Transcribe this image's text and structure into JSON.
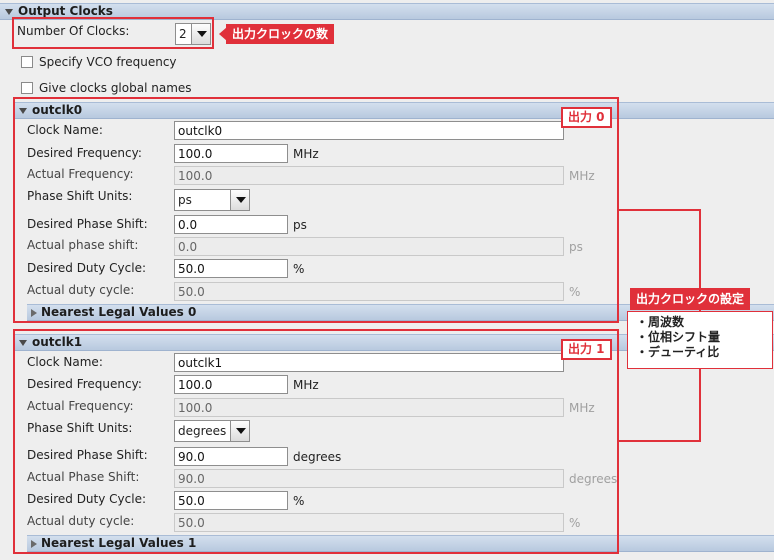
{
  "output_clocks": {
    "title": "Output Clocks",
    "num_clocks_label": "Number Of Clocks:",
    "num_clocks_value": "2",
    "specify_vco_label": "Specify VCO frequency",
    "global_names_label": "Give clocks global names"
  },
  "clocks": [
    {
      "title": "outclk0",
      "clock_name_label": "Clock Name:",
      "clock_name_value": "outclk0",
      "desired_freq_label": "Desired Frequency:",
      "desired_freq_value": "100.0",
      "desired_freq_unit": "MHz",
      "actual_freq_label": "Actual Frequency:",
      "actual_freq_value": "100.0",
      "actual_freq_unit": "MHz",
      "phase_units_label": "Phase Shift Units:",
      "phase_units_value": "ps",
      "desired_phase_label": "Desired Phase Shift:",
      "desired_phase_value": "0.0",
      "desired_phase_unit": "ps",
      "actual_phase_label": "Actual phase shift:",
      "actual_phase_value": "0.0",
      "actual_phase_unit": "ps",
      "desired_duty_label": "Desired Duty Cycle:",
      "desired_duty_value": "50.0",
      "desired_duty_unit": "%",
      "actual_duty_label": "Actual duty cycle:",
      "actual_duty_value": "50.0",
      "actual_duty_unit": "%",
      "nearest_label": "Nearest Legal Values 0"
    },
    {
      "title": "outclk1",
      "clock_name_label": "Clock Name:",
      "clock_name_value": "outclk1",
      "desired_freq_label": "Desired Frequency:",
      "desired_freq_value": "100.0",
      "desired_freq_unit": "MHz",
      "actual_freq_label": "Actual Frequency:",
      "actual_freq_value": "100.0",
      "actual_freq_unit": "MHz",
      "phase_units_label": "Phase Shift Units:",
      "phase_units_value": "degrees",
      "desired_phase_label": "Desired Phase Shift:",
      "desired_phase_value": "90.0",
      "desired_phase_unit": "degrees",
      "actual_phase_label": "Actual Phase Shift:",
      "actual_phase_value": "90.0",
      "actual_phase_unit": "degrees",
      "desired_duty_label": "Desired Duty Cycle:",
      "desired_duty_value": "50.0",
      "desired_duty_unit": "%",
      "actual_duty_label": "Actual duty cycle:",
      "actual_duty_value": "50.0",
      "actual_duty_unit": "%",
      "nearest_label": "Nearest Legal Values 1"
    }
  ],
  "annotations": {
    "num_clocks_callout": "出力クロックの数",
    "output0_tag": "出力 0",
    "output1_tag": "出力 1",
    "settings_title": "出力クロックの設定",
    "settings_items": [
      "・周波数",
      "・位相シフト量",
      "・デューティ比"
    ]
  },
  "colors": {
    "accent_red": "#e0303a",
    "header_blue": "#c6d5e9"
  }
}
